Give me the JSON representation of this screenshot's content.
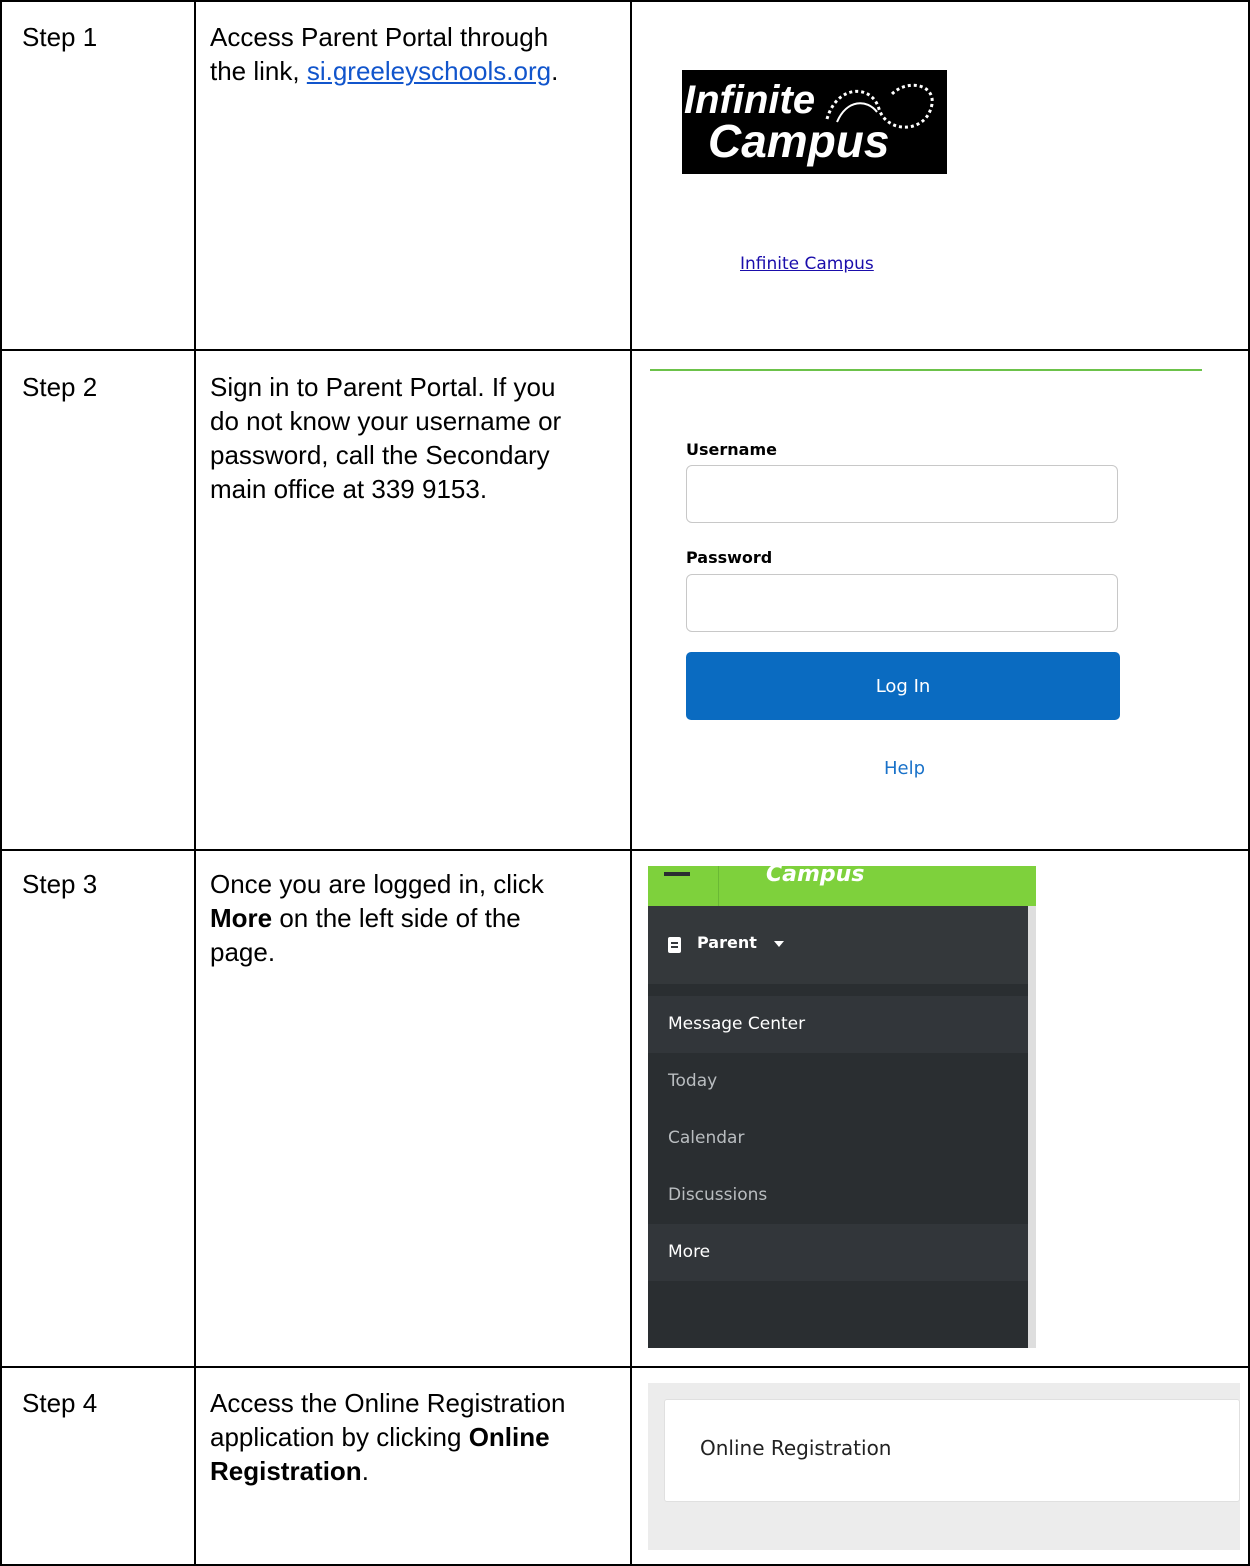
{
  "steps": [
    {
      "label": "Step 1"
    },
    {
      "label": "Step 2"
    },
    {
      "label": "Step 3"
    },
    {
      "label": "Step 4"
    }
  ],
  "step1": {
    "line1": "Access Parent Portal through",
    "line2_prefix": "the link, ",
    "link_text": "si.greeleyschools.org",
    "line2_suffix": ".",
    "logo_word1": "Infinite",
    "logo_word2": "Campus",
    "logo_link": "Infinite Campus"
  },
  "step2": {
    "lines": [
      "Sign in to Parent Portal. If you",
      "do not know your username or",
      "password, call the Secondary",
      "main office at 339 9153."
    ],
    "username_label": "Username",
    "password_label": "Password",
    "login_button": "Log In",
    "help_link": "Help"
  },
  "step3": {
    "line1": "Once you are logged in, click",
    "bold_word": "More",
    "line2_suffix": " on the left side of the",
    "line3": "page.",
    "brand": "Campus",
    "parent_label": "Parent",
    "nav_items": [
      "Message Center",
      "Today",
      "Calendar",
      "Discussions",
      "More"
    ]
  },
  "step4": {
    "line1": "Access the Online Registration",
    "line2_prefix": "application by clicking ",
    "bold_line2": "Online",
    "bold_line3": "Registration",
    "line3_suffix": ".",
    "card_label": "Online Registration"
  },
  "colors": {
    "link_blue": "#1155cc",
    "login_button": "#0a6bc1",
    "campus_green": "#7ed13c",
    "nav_dark": "#2a2e31"
  }
}
